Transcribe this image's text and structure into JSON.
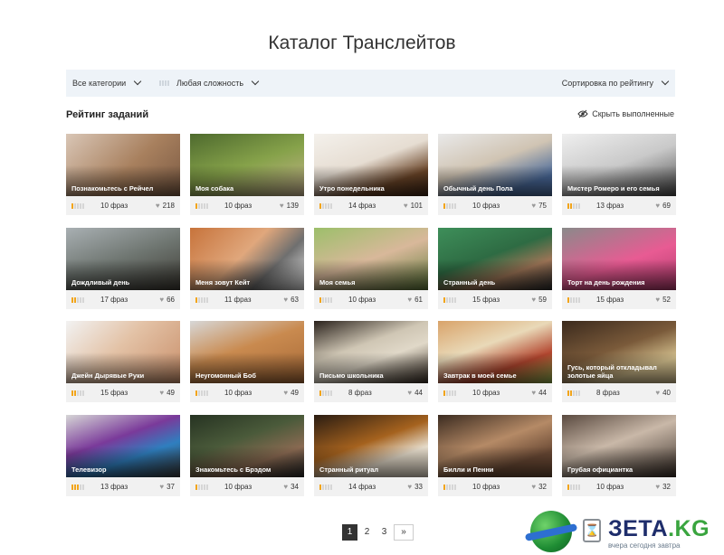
{
  "page": {
    "title": "Каталог Транслейтов"
  },
  "filters": {
    "category": "Все категории",
    "difficulty": "Любая сложность",
    "sort": "Сортировка по рейтингу"
  },
  "section": {
    "title": "Рейтинг заданий",
    "hide_done": "Скрыть выполненные"
  },
  "colors": {
    "accent": "#f2a51a",
    "filter_bg": "#eef3f8",
    "card_bg": "#f1f1f1",
    "pager_active": "#333333"
  },
  "cards": [
    {
      "title": "Познакомьтесь с Рейчел",
      "phrases": "10 фраз",
      "likes": "218",
      "level": 1,
      "bg": "linear-gradient(135deg,#d9c6b6,#a8805e 55%,#7b5a43)"
    },
    {
      "title": "Моя собака",
      "phrases": "10 фраз",
      "likes": "139",
      "level": 1,
      "bg": "linear-gradient(160deg,#4e6a2e,#86a24a 50%,#c9b48f)"
    },
    {
      "title": "Утро понедельника",
      "phrases": "14 фраз",
      "likes": "101",
      "level": 1,
      "bg": "linear-gradient(160deg,#f4f1ec,#e6ddd2 45%,#6b4528 75%,#3d2515)"
    },
    {
      "title": "Обычный день Пола",
      "phrases": "10 фраз",
      "likes": "75",
      "level": 1,
      "bg": "linear-gradient(160deg,#e9e9e9,#d0c4b3 45%,#4a6a9a 80%)"
    },
    {
      "title": "Мистер Ромеро и его семья",
      "phrases": "13 фраз",
      "likes": "69",
      "level": 2,
      "bg": "linear-gradient(160deg,#efefef,#c9c9c9 50%,#4a4a4a)"
    },
    {
      "title": "Дождливый день",
      "phrases": "17 фраз",
      "likes": "66",
      "level": 2,
      "bg": "linear-gradient(160deg,#a9b0b3,#6e7570 50%,#3d3a33)"
    },
    {
      "title": "Меня зовут Кейт",
      "phrases": "11 фраз",
      "likes": "63",
      "level": 1,
      "bg": "linear-gradient(135deg,#c7733b,#e0a77c 45%,#6f6f6f 70%,#e8e8e8)"
    },
    {
      "title": "Моя семья",
      "phrases": "10 фраз",
      "likes": "61",
      "level": 1,
      "bg": "linear-gradient(160deg,#9cbf6a,#d8b89a 50%,#5f7a3a)"
    },
    {
      "title": "Странный день",
      "phrases": "15 фраз",
      "likes": "59",
      "level": 1,
      "bg": "linear-gradient(160deg,#3e8f5a,#2e6b43 45%,#9c7456 70%,#2c2c2c)"
    },
    {
      "title": "Торт на день рождения",
      "phrases": "15 фраз",
      "likes": "52",
      "level": 1,
      "bg": "linear-gradient(160deg,#8a8a8a,#e85b93 55%,#b03a6c)"
    },
    {
      "title": "Джейн Дырявые Руки",
      "phrases": "15 фраз",
      "likes": "49",
      "level": 2,
      "bg": "linear-gradient(135deg,#f2f2f2,#e3c2a6 45%,#c98f6a)"
    },
    {
      "title": "Неугомонный Боб",
      "phrases": "10 фраз",
      "likes": "49",
      "level": 1,
      "bg": "linear-gradient(160deg,#d7d7d7,#c98a4f 45%,#a66836)"
    },
    {
      "title": "Письмо школьника",
      "phrases": "8 фраз",
      "likes": "44",
      "level": 1,
      "bg": "linear-gradient(160deg,#2a221c,#cfc6b4 40%,#e0d8c8 60%,#3a2f25)"
    },
    {
      "title": "Завтрак в моей семье",
      "phrases": "10 фраз",
      "likes": "44",
      "level": 1,
      "bg": "linear-gradient(160deg,#d9a36a,#e9d9b8 40%,#b3462f 70%,#8fb04d)"
    },
    {
      "title": "Гусь, который откладывал золотые яйца",
      "phrases": "8 фраз",
      "likes": "40",
      "level": 2,
      "bg": "linear-gradient(160deg,#3b2a1d,#7a5a3a 45%,#d4c08e 75%)"
    },
    {
      "title": "Телевизор",
      "phrases": "13 фраз",
      "likes": "37",
      "level": 3,
      "bg": "linear-gradient(160deg,#d6d6d6,#7a3a9a 40%,#2f7fbf 65%,#3a3a3a)"
    },
    {
      "title": "Знакомьтесь с Брэдом",
      "phrases": "10 фраз",
      "likes": "34",
      "level": 1,
      "bg": "linear-gradient(160deg,#263322,#4a5a3a 40%,#8a6a52 70%,#2a2a2a)"
    },
    {
      "title": "Странный ритуал",
      "phrases": "14 фраз",
      "likes": "33",
      "level": 1,
      "bg": "linear-gradient(160deg,#2a1c12,#a5621e 45%,#e6dccb 70%)"
    },
    {
      "title": "Билли и Пенни",
      "phrases": "10 фраз",
      "likes": "32",
      "level": 1,
      "bg": "linear-gradient(160deg,#3b2b20,#b58a66 45%,#6b4a35 75%)"
    },
    {
      "title": "Грубая официантка",
      "phrases": "10 фраз",
      "likes": "32",
      "level": 1,
      "bg": "linear-gradient(160deg,#5a4a40,#c9b8a8 45%,#3a2f28)"
    }
  ],
  "pagination": {
    "pages": [
      "1",
      "2",
      "3"
    ],
    "active": "1",
    "next": "»"
  },
  "watermark": {
    "brand": "ЗЕТА",
    "suffix": ".KG",
    "tagline": "вчера сегодня завтра",
    "hourglass": "⌛"
  }
}
